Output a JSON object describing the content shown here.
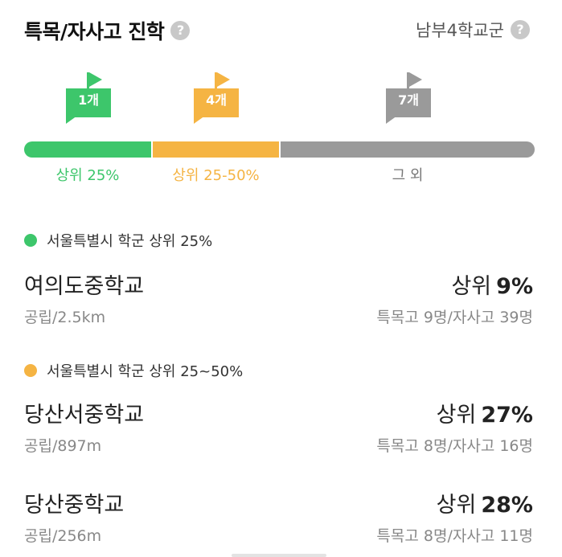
{
  "header": {
    "title": "특목/자사고 진학",
    "help_glyph": "?",
    "district": "남부4학교군"
  },
  "colors": {
    "top25": "#3dc66b",
    "top25_50": "#f5b443",
    "others": "#9a9a9a"
  },
  "distribution": [
    {
      "count": "1개",
      "label": "상위 25%"
    },
    {
      "count": "4개",
      "label": "상위 25-50%"
    },
    {
      "count": "7개",
      "label": "그 외"
    }
  ],
  "groups": [
    {
      "heading": "서울특별시 학군 상위 25%",
      "schools": [
        {
          "name": "여의도중학교",
          "meta": "공립/2.5km",
          "rank_prefix": "상위",
          "rank_value": "9%",
          "counts": "특목고 9명/자사고 39명"
        }
      ]
    },
    {
      "heading": "서울특별시 학군 상위 25~50%",
      "schools": [
        {
          "name": "당산서중학교",
          "meta": "공립/897m",
          "rank_prefix": "상위",
          "rank_value": "27%",
          "counts": "특목고 8명/자사고 16명"
        },
        {
          "name": "당산중학교",
          "meta": "공립/256m",
          "rank_prefix": "상위",
          "rank_value": "28%",
          "counts": "특목고 8명/자사고 11명"
        }
      ]
    }
  ]
}
